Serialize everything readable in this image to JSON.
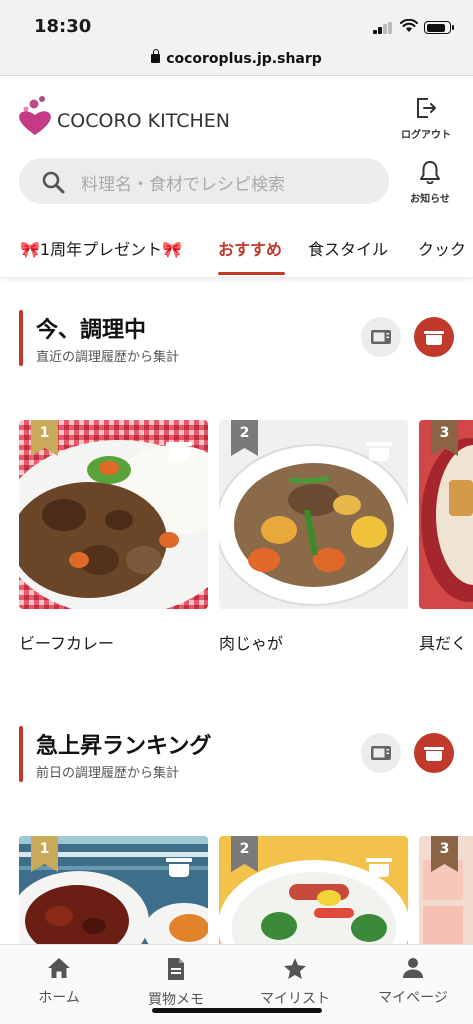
{
  "status_bar": {
    "time": "18:30"
  },
  "browser": {
    "url": "cocoroplus.jp.sharp"
  },
  "header": {
    "logo_text": "COCORO KITCHEN",
    "logout_label": "ログアウト",
    "search_placeholder": "料理名・食材でレシピ検索",
    "notice_label": "お知らせ"
  },
  "tabs": [
    {
      "label": "🎀1周年プレゼント🎀"
    },
    {
      "label": "おすすめ"
    },
    {
      "label": "食スタイル"
    },
    {
      "label": "クック"
    }
  ],
  "sections": [
    {
      "title": "今、調理中",
      "subtitle": "直近の調理履歴から集計",
      "cards": [
        {
          "rank": "1",
          "name": "ビーフカレー"
        },
        {
          "rank": "2",
          "name": "肉じゃが"
        },
        {
          "rank": "3",
          "name": "具だく"
        }
      ]
    },
    {
      "title": "急上昇ランキング",
      "subtitle": "前日の調理履歴から集計",
      "cards": [
        {
          "rank": "1",
          "name": ""
        },
        {
          "rank": "2",
          "name": ""
        },
        {
          "rank": "3",
          "name": ""
        }
      ]
    }
  ],
  "bottom_nav": [
    {
      "label": "ホーム",
      "icon": "home-icon"
    },
    {
      "label": "買物メモ",
      "icon": "memo-icon"
    },
    {
      "label": "マイリスト",
      "icon": "star-icon"
    },
    {
      "label": "マイページ",
      "icon": "person-icon"
    }
  ],
  "colors": {
    "accent": "#c0392b",
    "rank1": "#c9a95a",
    "rank2": "#7a7a7a",
    "rank3": "#8b6445"
  }
}
